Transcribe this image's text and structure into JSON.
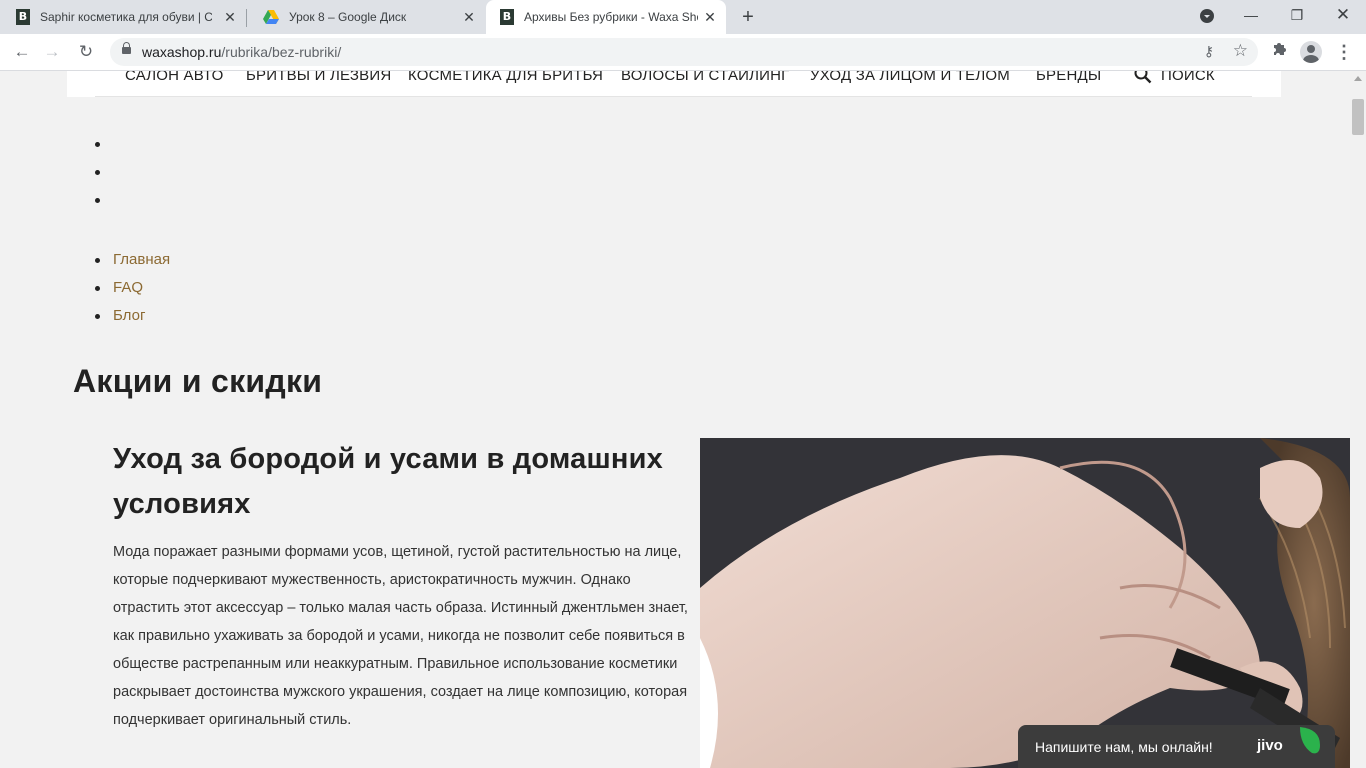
{
  "browser": {
    "tabs": [
      {
        "title": "Saphir косметика для обуви | Са",
        "favicon": "waxa-b-icon",
        "active": false
      },
      {
        "title": "Урок 8 – Google Диск",
        "favicon": "google-drive-icon",
        "active": false
      },
      {
        "title": "Архивы Без рубрики - Waxa Sho",
        "favicon": "waxa-b-icon",
        "active": true
      }
    ],
    "favicon_letter": "B",
    "url_host": "waxashop.ru",
    "url_path": "/rubrika/bez-rubriki/"
  },
  "site": {
    "menu": [
      "Салон авто",
      "Бритвы и лезвия",
      "Косметика для бритья",
      "Волосы и стайлинг",
      "Уход за лицом и телом",
      "Бренды"
    ],
    "search_label": "Поиск",
    "links": [
      "Главная",
      "FAQ",
      "Блог"
    ],
    "section_title": "Акции и скидки",
    "post": {
      "title": "Уход за бородой и усами в домашних условиях",
      "excerpt": "Мода поражает разными формами усов, щетиной, густой растительностью на лице, которые подчеркивают мужественность, аристократичность мужчин. Однако отрастить этот аксессуар – только малая часть образа. Истинный джентльмен знает, как правильно ухаживать за бородой и усами, никогда не позволит себе появиться в обществе растрепанным или неаккуратным. Правильное использование косметики раскрывает достоинства мужского украшения, создает на лице композицию, которая подчеркивает оригинальный стиль."
    },
    "chat": {
      "text": "Напишите нам, мы онлайн!",
      "logo": "jivo"
    }
  },
  "colors": {
    "link": "#8c6a33",
    "page_bg": "#f2f2f2",
    "chat_bg": "#3c3c3c",
    "jivo_leaf": "#2bb24c"
  }
}
